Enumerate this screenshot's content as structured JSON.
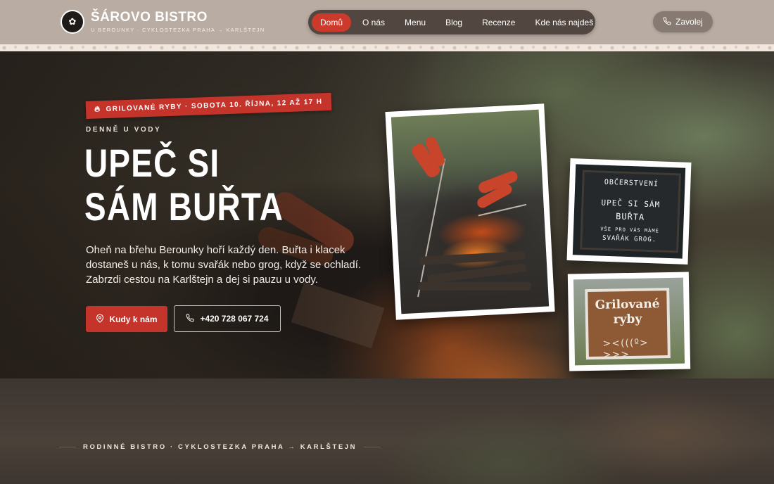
{
  "brand": {
    "name": "ŠÁROVO BISTRO",
    "subtitle": "U BEROUNKY · CYKLOSTEZKA PRAHA → KARLŠTEJN",
    "badge": "✿"
  },
  "nav": {
    "items": [
      {
        "label": "Domů",
        "active": true
      },
      {
        "label": "O nás",
        "active": false
      },
      {
        "label": "Menu",
        "active": false
      },
      {
        "label": "Blog",
        "active": false
      },
      {
        "label": "Recenze",
        "active": false
      },
      {
        "label": "Kde nás najdeš",
        "active": false
      }
    ],
    "call_label": "Zavolej"
  },
  "hero": {
    "event_tag": "GRILOVANÉ RYBY · SOBOTA 10. ŘÍJNA, 12 AŽ 17 H",
    "kicker": "DENNĚ U VODY",
    "headline_line1": "UPEČ SI",
    "headline_line2": "SÁM BUŘTA",
    "lead": "Oheň na břehu Berounky hoří každý den. Buřta i klacek dostaneš u nás, k tomu svařák nebo grog, když se ochladí. Zabrzdi cestou na Karlštejn a dej si pauzu u vody.",
    "primary_button": "Kudy k nám",
    "phone_button": "+420 728 067 724"
  },
  "photos": {
    "board_lines": [
      "OBČERSTVENÍ",
      "UPEČ SI SÁM",
      "BUŘTA",
      "VŠE PRO VÁS MÁME",
      "SVAŘÁK GROG."
    ],
    "sign_lines": [
      "Grilované",
      "ryby"
    ],
    "sign_fish": "><(((º> >>>"
  },
  "footer_band": {
    "tagline": "RODINNÉ BISTRO · CYKLOSTEZKA PRAHA → KARLŠTEJN"
  },
  "colors": {
    "accent": "#c5342b",
    "header": "#b9aca3",
    "nav_bg": "#524740"
  }
}
